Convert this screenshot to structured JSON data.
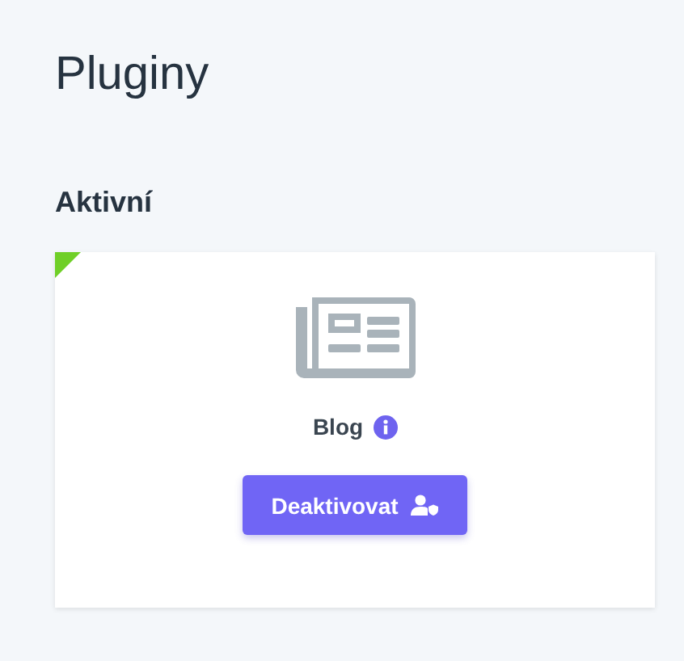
{
  "page": {
    "title": "Pluginy"
  },
  "section": {
    "heading": "Aktivní"
  },
  "plugins": [
    {
      "name": "Blog",
      "active": true,
      "button": "Deaktivovat"
    }
  ]
}
